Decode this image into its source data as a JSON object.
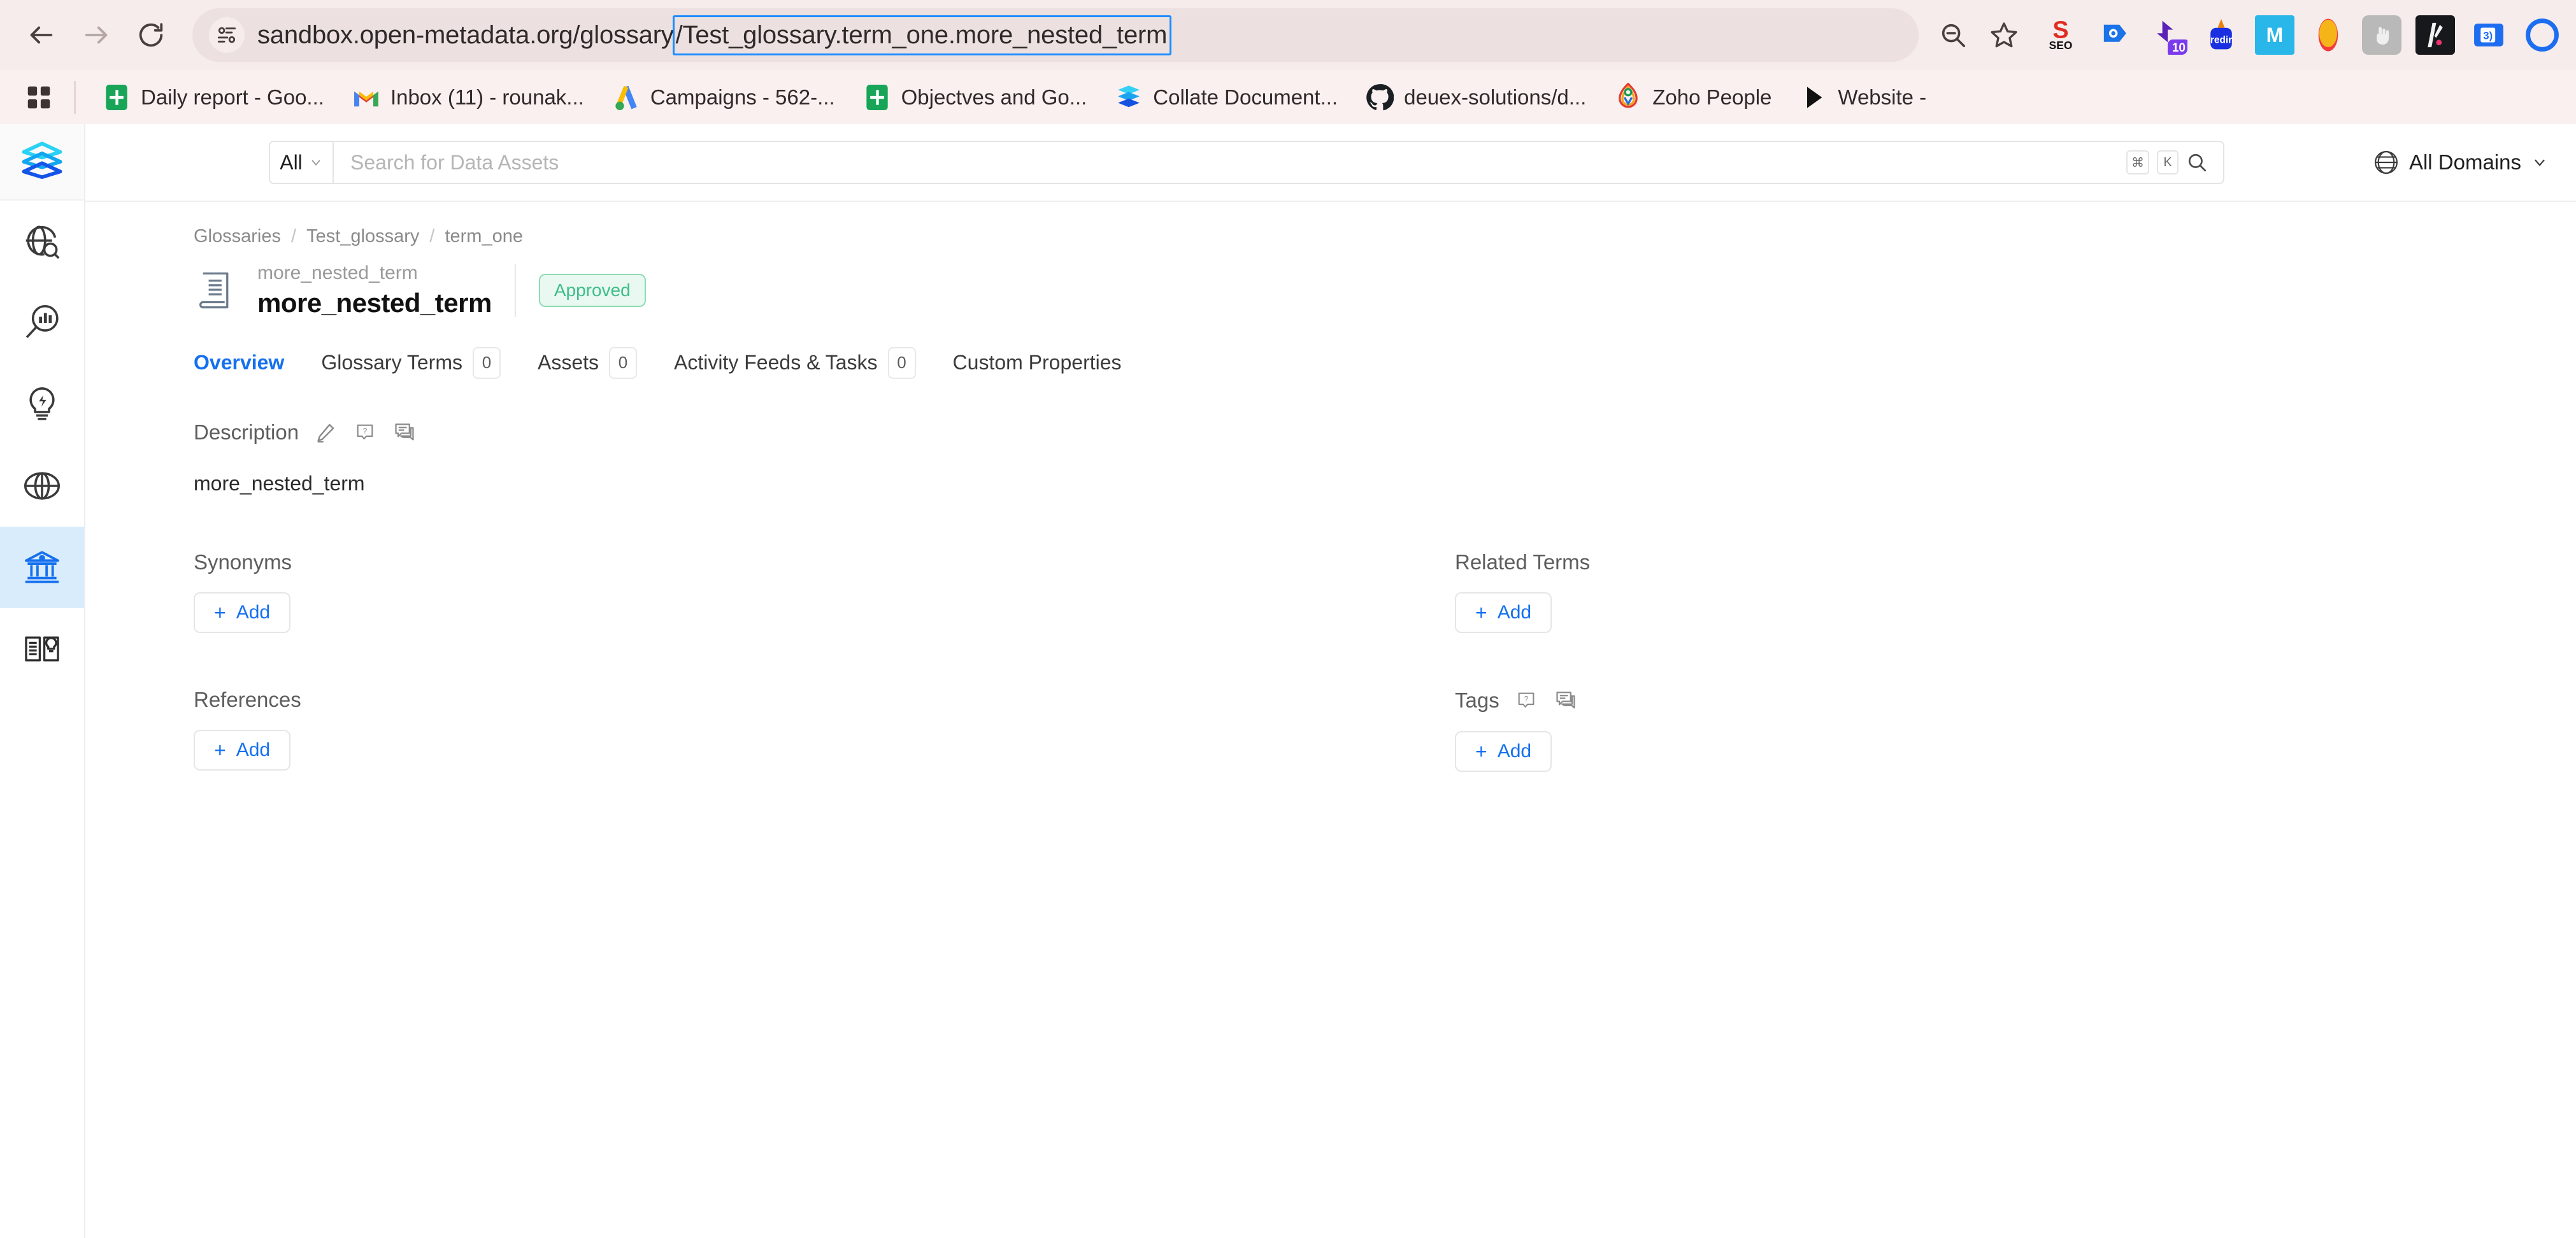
{
  "browser": {
    "nav": {
      "back_label": "Back",
      "forward_label": "Forward",
      "reload_label": "Reload"
    },
    "omnibox": {
      "site_info_label": "View site information",
      "url_prefix": "sandbox.open-metadata.org/glossary",
      "url_selected": "/Test_glossary.term_one.more_nested_term",
      "zoom_label": "Zoom",
      "bookmark_label": "Bookmark this tab"
    },
    "extensions": [
      {
        "name": "seo-extension-icon",
        "label": "SEO"
      },
      {
        "name": "tag-extension-icon",
        "label": ""
      },
      {
        "name": "purple-badge-extension-icon",
        "label": "10"
      },
      {
        "name": "redirector-extension-icon",
        "label": "redir"
      },
      {
        "name": "mailtrack-extension-icon",
        "label": "M"
      },
      {
        "name": "orange-circle-extension-icon",
        "label": ""
      },
      {
        "name": "hand-cursor-extension-icon",
        "label": ""
      },
      {
        "name": "dark-stripe-extension-icon",
        "label": ""
      },
      {
        "name": "blue-note-extension-icon",
        "label": ""
      },
      {
        "name": "chrome-profile-icon",
        "label": ""
      }
    ],
    "bookmarks": [
      {
        "label": "Daily report - Goo...",
        "icon": "google-sheets-icon"
      },
      {
        "label": "Inbox (11) - rounak...",
        "icon": "gmail-icon"
      },
      {
        "label": "Campaigns - 562-...",
        "icon": "google-ads-icon"
      },
      {
        "label": "Objectves and Go...",
        "icon": "google-sheets-icon"
      },
      {
        "label": "Collate Document...",
        "icon": "collate-icon"
      },
      {
        "label": "deuex-solutions/d...",
        "icon": "github-icon"
      },
      {
        "label": "Zoho People",
        "icon": "zoho-people-icon"
      },
      {
        "label": "Website -",
        "icon": "play-icon"
      }
    ],
    "apps_button_label": "Bookmarks"
  },
  "sidebar": {
    "logo_label": "OpenMetadata",
    "items": [
      {
        "name": "explore",
        "icon": "globe-search-icon",
        "active": false
      },
      {
        "name": "observability",
        "icon": "magnifier-chart-icon",
        "active": false
      },
      {
        "name": "insights",
        "icon": "lightbulb-icon",
        "active": false
      },
      {
        "name": "domains",
        "icon": "globe-icon",
        "active": false
      },
      {
        "name": "govern",
        "icon": "bank-icon",
        "active": true
      },
      {
        "name": "glossary",
        "icon": "open-book-icon",
        "active": false
      }
    ]
  },
  "topbar": {
    "scope_label": "All",
    "search_placeholder": "Search for Data Assets",
    "search_value": "",
    "kbd_cmd": "⌘",
    "kbd_key": "K",
    "domain_label": "All Domains"
  },
  "breadcrumb": [
    "Glossaries",
    "Test_glossary",
    "term_one"
  ],
  "header": {
    "supertitle": "more_nested_term",
    "title": "more_nested_term",
    "status_badge": "Approved"
  },
  "tabs": [
    {
      "label": "Overview",
      "count": null,
      "active": true
    },
    {
      "label": "Glossary Terms",
      "count": "0",
      "active": false
    },
    {
      "label": "Assets",
      "count": "0",
      "active": false
    },
    {
      "label": "Activity Feeds & Tasks",
      "count": "0",
      "active": false
    },
    {
      "label": "Custom Properties",
      "count": null,
      "active": false
    }
  ],
  "description": {
    "title": "Description",
    "body": "more_nested_term",
    "actions": [
      "edit-icon",
      "help-icon",
      "comment-icon"
    ]
  },
  "sections": {
    "synonyms": {
      "title": "Synonyms",
      "add_label": "Add",
      "add_plus": "+"
    },
    "related_terms": {
      "title": "Related Terms",
      "add_label": "Add",
      "add_plus": "+"
    },
    "references": {
      "title": "References",
      "add_label": "Add",
      "add_plus": "+"
    },
    "tags": {
      "title": "Tags",
      "add_label": "Add",
      "add_plus": "+",
      "actions": [
        "help-icon",
        "comment-icon"
      ]
    }
  },
  "colors": {
    "accent_blue": "#1570ef",
    "status_green": "#3fbd89",
    "status_green_bg": "#e9f9f1",
    "chrome_bg": "#f6eceb",
    "sidebar_active": "#d9ecfb",
    "url_highlight": "#1a8cff"
  }
}
